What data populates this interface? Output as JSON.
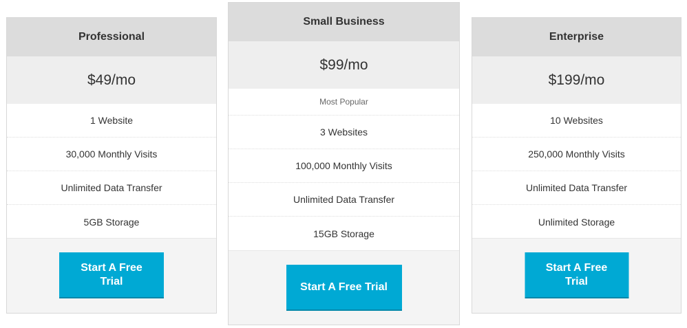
{
  "plans": [
    {
      "name": "Professional",
      "price": "$49/mo",
      "features": [
        "1 Website",
        "30,000 Monthly Visits",
        "Unlimited Data Transfer",
        "5GB Storage"
      ],
      "cta": "Start A Free Trial"
    },
    {
      "name": "Small Business",
      "price": "$99/mo",
      "note": "Most Popular",
      "features": [
        "3 Websites",
        "100,000 Monthly Visits",
        "Unlimited Data Transfer",
        "15GB Storage"
      ],
      "cta": "Start A Free Trial"
    },
    {
      "name": "Enterprise",
      "price": "$199/mo",
      "features": [
        "10 Websites",
        "250,000 Monthly Visits",
        "Unlimited Data Transfer",
        "Unlimited Storage"
      ],
      "cta": "Start A Free Trial"
    }
  ],
  "colors": {
    "header_bg": "#dcdcdc",
    "price_bg": "#eeeeee",
    "footer_bg": "#f4f4f4",
    "cta_bg": "#00a9d4",
    "cta_text": "#ffffff"
  }
}
